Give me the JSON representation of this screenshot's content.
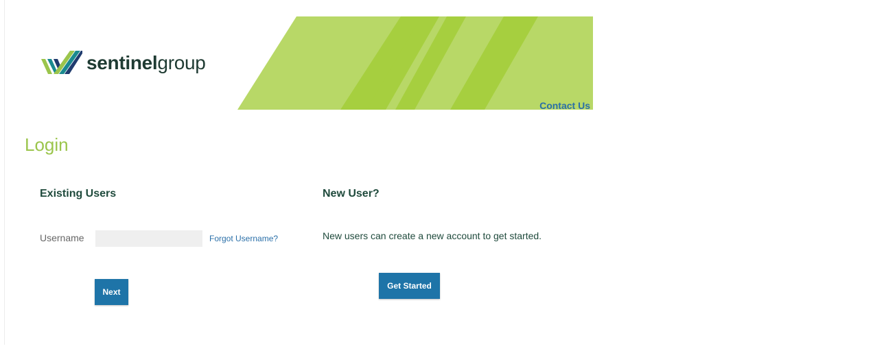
{
  "brand": {
    "name_bold": "sentinel",
    "name_light": "group",
    "logo_icon": "sentinel-chevron-logo",
    "colors": {
      "green": "#9bc54c",
      "teal": "#1b8a8f",
      "navy": "#1f3b6e",
      "text": "#1f3b33"
    }
  },
  "header": {
    "contact_label": "Contact Us",
    "banner_colors": {
      "light_green": "#b8d867",
      "mid_green": "#a6cf3f"
    }
  },
  "page": {
    "title": "Login"
  },
  "existing_users": {
    "heading": "Existing Users",
    "username_label": "Username",
    "username_value": "",
    "username_placeholder": "",
    "forgot_label": "Forgot Username?",
    "next_label": "Next"
  },
  "new_user": {
    "heading": "New User?",
    "description": "New users can create a new account to get started.",
    "button_label": "Get Started"
  },
  "colors": {
    "accent_button": "#1e74a8",
    "link": "#2a6fa8",
    "title_green": "#9bc54c",
    "heading_dark_green": "#1f4a3c"
  }
}
